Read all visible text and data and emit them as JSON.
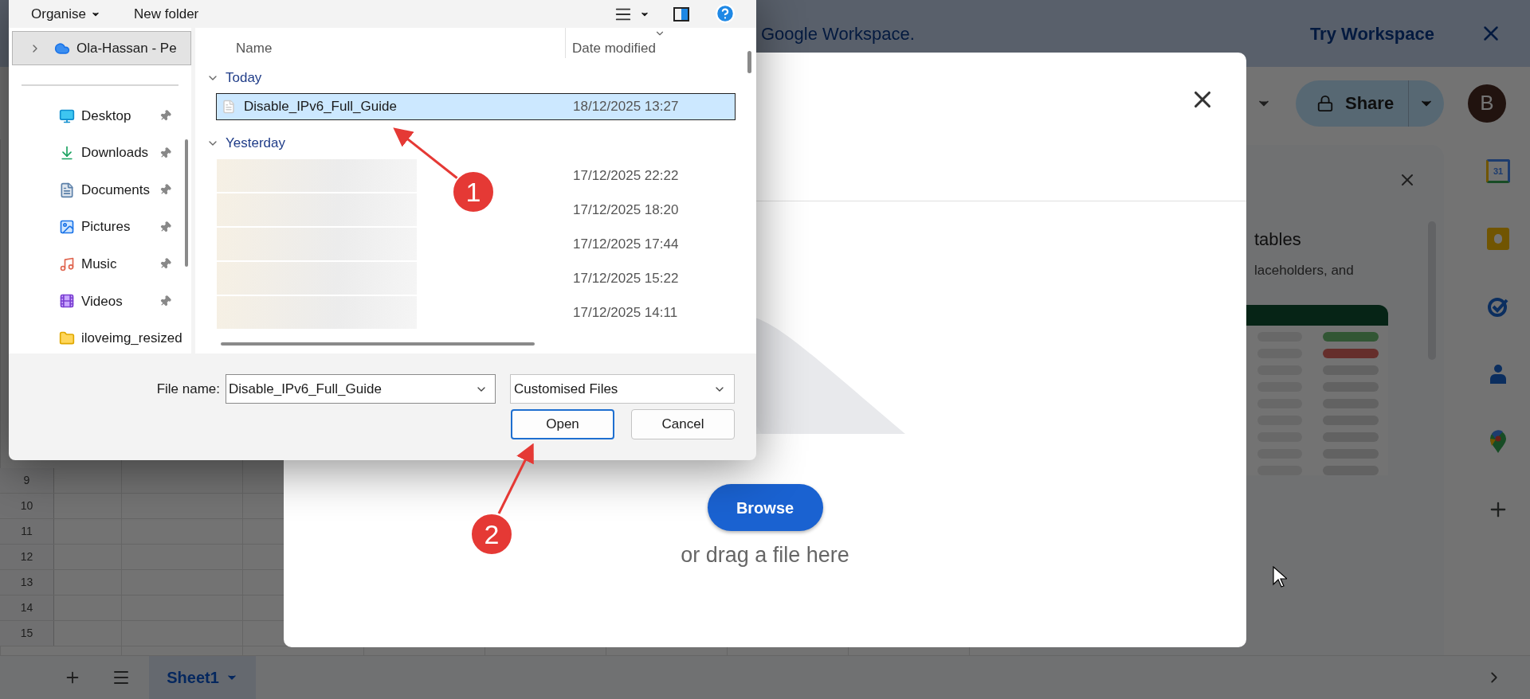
{
  "banner": {
    "text": "Google Workspace.",
    "action": "Try Workspace"
  },
  "toolbar": {
    "share": "Share",
    "avatar": "B"
  },
  "side_panel": {
    "heading": "tables",
    "body": "laceholders, and"
  },
  "side_icons": [
    {
      "kind": "calendar",
      "label": "31"
    },
    {
      "kind": "keep"
    },
    {
      "kind": "tasks"
    },
    {
      "kind": "contacts"
    },
    {
      "kind": "maps"
    },
    {
      "kind": "add"
    }
  ],
  "sheet": {
    "row_numbers": [
      "9",
      "10",
      "11",
      "12",
      "13",
      "14",
      "15"
    ],
    "tabs": [
      {
        "label": "Sheet1",
        "selected": true
      }
    ]
  },
  "upload_dialog": {
    "button": "Browse",
    "hint": "or drag a file here"
  },
  "file_dialog": {
    "commands": [
      {
        "label": "Organise",
        "kind": "menu"
      },
      {
        "label": "New folder",
        "kind": "plain"
      }
    ],
    "nav": [
      {
        "label": "Ola-Hassan - Pe",
        "kind": "cloud",
        "selected": true,
        "pinned": false
      },
      {
        "label": "Desktop",
        "kind": "desktop",
        "selected": false,
        "pinned": true
      },
      {
        "label": "Downloads",
        "kind": "downloads",
        "selected": false,
        "pinned": true
      },
      {
        "label": "Documents",
        "kind": "documents",
        "selected": false,
        "pinned": true
      },
      {
        "label": "Pictures",
        "kind": "pictures",
        "selected": false,
        "pinned": true
      },
      {
        "label": "Music",
        "kind": "music",
        "selected": false,
        "pinned": true
      },
      {
        "label": "Videos",
        "kind": "videos",
        "selected": false,
        "pinned": true
      },
      {
        "label": "iloveimg_resized",
        "kind": "folder",
        "selected": false,
        "pinned": false
      }
    ],
    "columns": [
      "Name",
      "Date modified"
    ],
    "groups": [
      {
        "label": "Today",
        "expanded": true,
        "files": [
          {
            "name": "Disable_IPv6_Full_Guide",
            "date": "18/12/2025 13:27",
            "selected": true
          }
        ]
      },
      {
        "label": "Yesterday",
        "expanded": true,
        "files": [
          {
            "date": "17/12/2025 22:22",
            "selected": false
          },
          {
            "date": "17/12/2025 18:20",
            "selected": false
          },
          {
            "date": "17/12/2025 17:44",
            "selected": false
          },
          {
            "date": "17/12/2025 15:22",
            "selected": false
          },
          {
            "date": "17/12/2025 14:11",
            "selected": false
          }
        ]
      }
    ],
    "file_name_label": "File name:",
    "file_name": "Disable_IPv6_Full_Guide",
    "file_type": "Customised Files",
    "buttons": [
      {
        "label": "Open",
        "kind": "default"
      },
      {
        "label": "Cancel",
        "kind": "normal"
      }
    ]
  },
  "annotations": [
    {
      "label": "1"
    },
    {
      "label": "2"
    }
  ]
}
